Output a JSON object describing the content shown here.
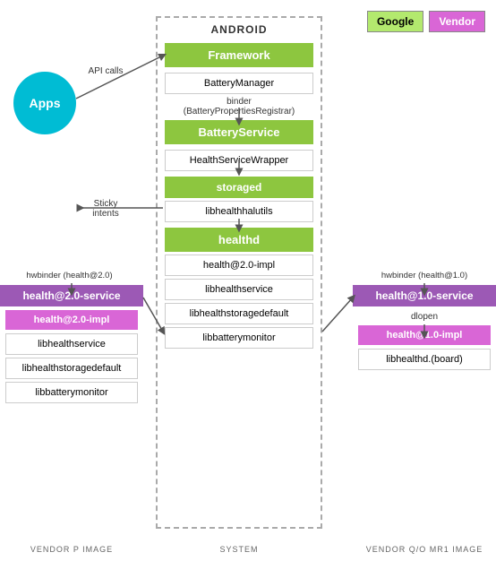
{
  "legend": {
    "google_label": "Google",
    "vendor_label": "Vendor"
  },
  "android": {
    "title": "ANDROID",
    "framework_label": "Framework",
    "battery_manager_label": "BatteryManager",
    "binder_label": "binder",
    "binder_sub": "(BatteryPropertiesRegistrar)",
    "battery_service_label": "BatteryService",
    "health_service_wrapper_label": "HealthServiceWrapper",
    "storaged_label": "storaged",
    "libhealthhalutils_label": "libhealthhalutils",
    "healthd_label": "healthd",
    "healthd_health_impl_label": "health@2.0-impl",
    "healthd_libhealthservice_label": "libhealthservice",
    "healthd_libstoragedefault_label": "libhealthstoragedefault",
    "healthd_libbattery_label": "libbatterymonitor"
  },
  "left_vendor": {
    "header": "health@2.0-service",
    "impl": "health@2.0-impl",
    "lib1": "libhealthservice",
    "lib2": "libhealthstoragedefault",
    "lib3": "libbatterymonitor",
    "hwbinder_label": "hwbinder (health@2.0)",
    "section_label": "VENDOR P IMAGE"
  },
  "right_vendor": {
    "header": "health@1.0-service",
    "impl": "health@1.0-impl",
    "lib1": "libhealthd.(board)",
    "hwbinder_label": "hwbinder (health@1.0)",
    "dlopen_label": "dlopen",
    "section_label": "VENDOR Q/O MR1 IMAGE"
  },
  "annotations": {
    "api_calls": "API\ncalls",
    "sticky_intents": "Sticky\nintents"
  }
}
